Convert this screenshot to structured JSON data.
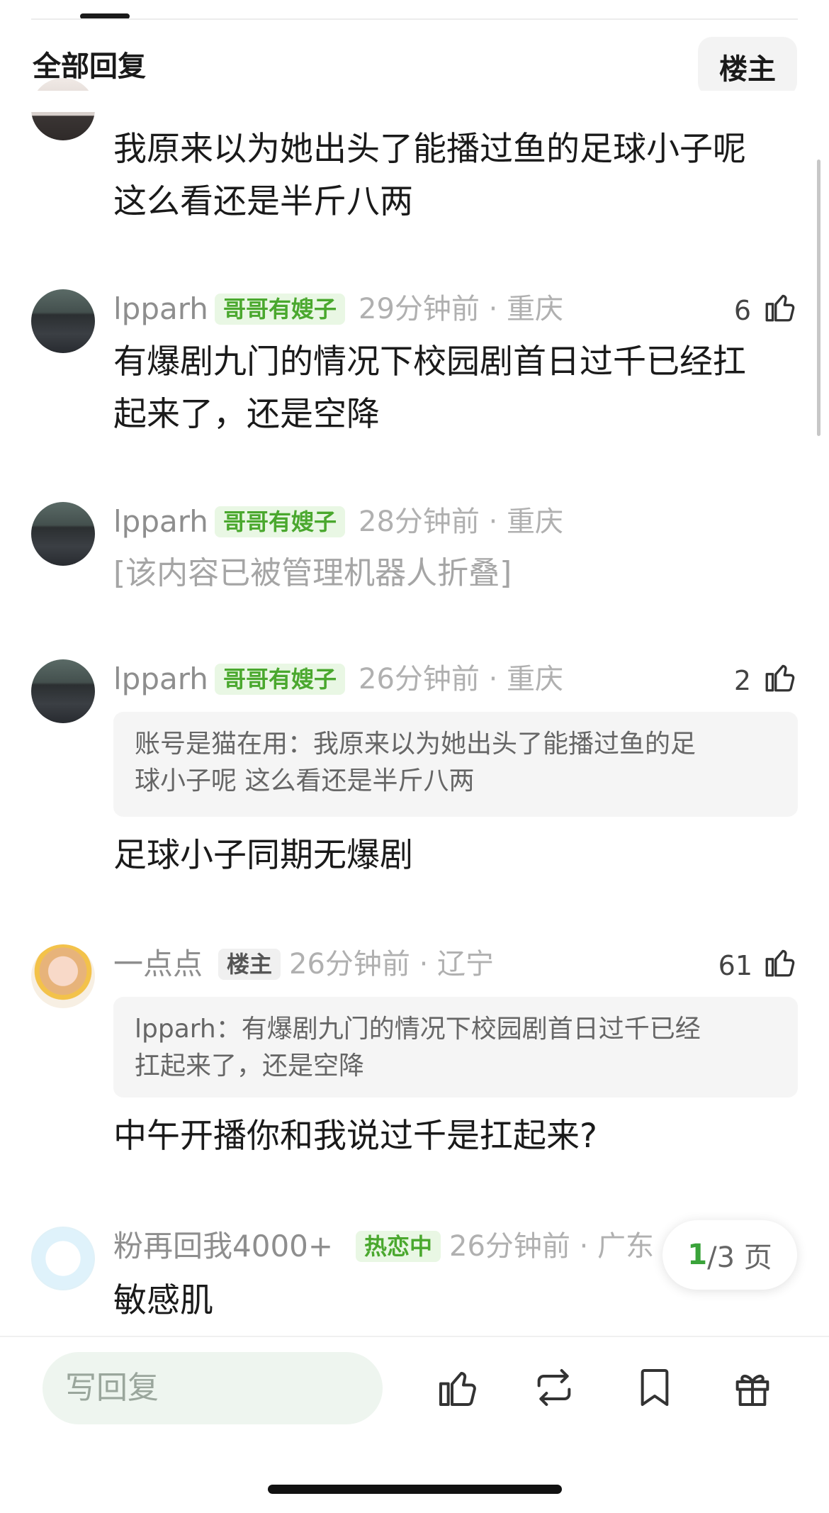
{
  "header": {
    "title": "全部回复",
    "op_button": "楼主"
  },
  "comments": [
    {
      "text_line1": "我原来以为她出头了能播过鱼的足球小子呢",
      "text_line2": "这么看还是半斤八两"
    },
    {
      "username": "lpparh",
      "badge": "哥哥有嫂子",
      "time_location": "29分钟前 · 重庆",
      "likes": "6",
      "text_line1": "有爆剧九门的情况下校园剧首日过千已经扛",
      "text_line2": "起来了，还是空降"
    },
    {
      "username": "lpparh",
      "badge": "哥哥有嫂子",
      "time_location": "28分钟前 · 重庆",
      "folded_text": "[该内容已被管理机器人折叠]"
    },
    {
      "username": "lpparh",
      "badge": "哥哥有嫂子",
      "time_location": "26分钟前 · 重庆",
      "likes": "2",
      "quote_line1": "账号是猫在用：我原来以为她出头了能播过鱼的足",
      "quote_line2": "球小子呢 这么看还是半斤八两",
      "text_line1": "足球小子同期无爆剧"
    },
    {
      "username": "一点点",
      "badge": "楼主",
      "time_location": "26分钟前 · 辽宁",
      "likes": "61",
      "quote_line1": "lpparh：有爆剧九门的情况下校园剧首日过千已经",
      "quote_line2": "扛起来了，还是空降",
      "text_line1": "中午开播你和我说过千是扛起来?"
    },
    {
      "username": "粉再回我4000+",
      "badge": "热恋中",
      "time_location": "26分钟前 · 广东",
      "text_line1": "敏感肌"
    }
  ],
  "pagination": {
    "current": "1",
    "total": "/3 页"
  },
  "bottom_bar": {
    "reply_placeholder": "写回复"
  },
  "colors": {
    "accent_green": "#4aa82e",
    "badge_bg": "#e9f7e4"
  },
  "icons": [
    "thumb-up-icon",
    "repost-icon",
    "bookmark-icon",
    "gift-icon"
  ]
}
